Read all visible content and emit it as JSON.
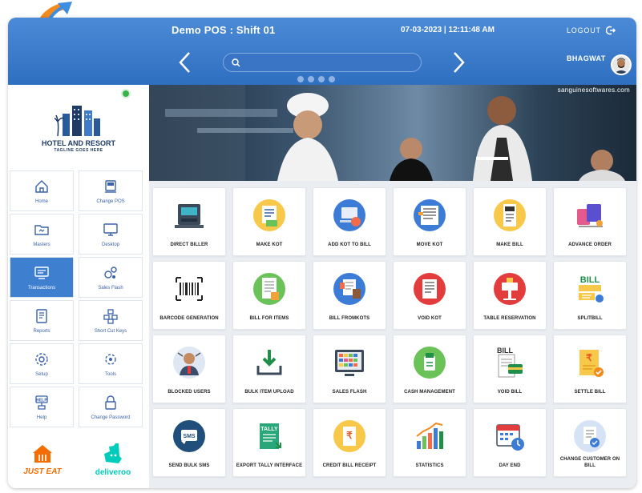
{
  "header": {
    "title": "Demo POS : Shift 01",
    "datetime": "07-03-2023 | 12:11:48 AM",
    "logout_label": "LOGOUT",
    "user_name": "BHAGWAT",
    "search": {
      "placeholder": "",
      "value": ""
    },
    "carousel_page_count": 4
  },
  "sidebar": {
    "hotel_name": "HOTEL AND RESORT",
    "tagline": "TAGLINE GOES HERE",
    "status_color": "#38b34a",
    "nav_items": [
      {
        "label": "Home",
        "icon": "home-icon",
        "active": false
      },
      {
        "label": "Change POS",
        "icon": "change-pos-icon",
        "active": false
      },
      {
        "label": "Masters",
        "icon": "masters-folder-icon",
        "active": false
      },
      {
        "label": "Desktop",
        "icon": "desktop-icon",
        "active": false
      },
      {
        "label": "Transactions",
        "icon": "transactions-icon",
        "active": true
      },
      {
        "label": "Sales Flash",
        "icon": "sales-flash-icon",
        "active": false
      },
      {
        "label": "Reports",
        "icon": "reports-icon",
        "active": false
      },
      {
        "label": "Short Cut Keys",
        "icon": "shortcut-keys-icon",
        "active": false
      },
      {
        "label": "Setup",
        "icon": "setup-gear-icon",
        "active": false
      },
      {
        "label": "Tools",
        "icon": "tools-icon",
        "active": false
      },
      {
        "label": "Help",
        "icon": "help-icon",
        "active": false
      },
      {
        "label": "Change Password",
        "icon": "lock-icon",
        "active": false
      }
    ],
    "delivery": [
      {
        "label": "JUST EAT",
        "icon": "just-eat-logo",
        "color": "#f36d00"
      },
      {
        "label": "deliveroo",
        "icon": "deliveroo-logo",
        "color": "#00ccbc"
      }
    ]
  },
  "banner": {
    "website": "sanguinesoftwares.com"
  },
  "tiles": [
    {
      "label": "DIRECT BILLER",
      "icon": "direct-biller-icon"
    },
    {
      "label": "MAKE KOT",
      "icon": "make-kot-icon"
    },
    {
      "label": "ADD KOT TO BILL",
      "icon": "add-kot-to-bill-icon"
    },
    {
      "label": "MOVE KOT",
      "icon": "move-kot-icon"
    },
    {
      "label": "MAKE BILL",
      "icon": "make-bill-icon"
    },
    {
      "label": "ADVANCE ORDER",
      "icon": "advance-order-icon"
    },
    {
      "label": "BARCODE GENERATION",
      "icon": "barcode-icon"
    },
    {
      "label": "BILL FOR ITEMS",
      "icon": "bill-for-items-icon"
    },
    {
      "label": "BILL FROMKOTS",
      "icon": "bill-from-kots-icon"
    },
    {
      "label": "VOID KOT",
      "icon": "void-kot-icon"
    },
    {
      "label": "TABLE RESERVATION",
      "icon": "table-reservation-icon"
    },
    {
      "label": "SPLITBILL",
      "icon": "split-bill-icon",
      "icon_text": "BILL"
    },
    {
      "label": "BLOCKED USERS",
      "icon": "blocked-users-icon"
    },
    {
      "label": "BULK ITEM UPLOAD",
      "icon": "bulk-upload-icon"
    },
    {
      "label": "SALES FLASH",
      "icon": "sales-flash-monitor-icon"
    },
    {
      "label": "CASH MANAGEMENT",
      "icon": "cash-management-icon"
    },
    {
      "label": "VOID BILL",
      "icon": "void-bill-icon",
      "icon_text": "BILL"
    },
    {
      "label": "SETTLE BILL",
      "icon": "settle-bill-icon",
      "icon_text": "₹"
    },
    {
      "label": "SEND BULK SMS",
      "icon": "bulk-sms-icon",
      "icon_text": "SMS"
    },
    {
      "label": "EXPORT TALLY INTERFACE",
      "icon": "export-tally-icon",
      "icon_text": "TALLY"
    },
    {
      "label": "CREDIT BILL RECEIPT",
      "icon": "credit-bill-receipt-icon",
      "icon_text": "₹"
    },
    {
      "label": "STATISTICS",
      "icon": "statistics-chart-icon"
    },
    {
      "label": "DAY END",
      "icon": "day-end-calendar-icon"
    },
    {
      "label": "CHANGE CUSTOMER ON BILL",
      "icon": "change-customer-icon"
    }
  ]
}
